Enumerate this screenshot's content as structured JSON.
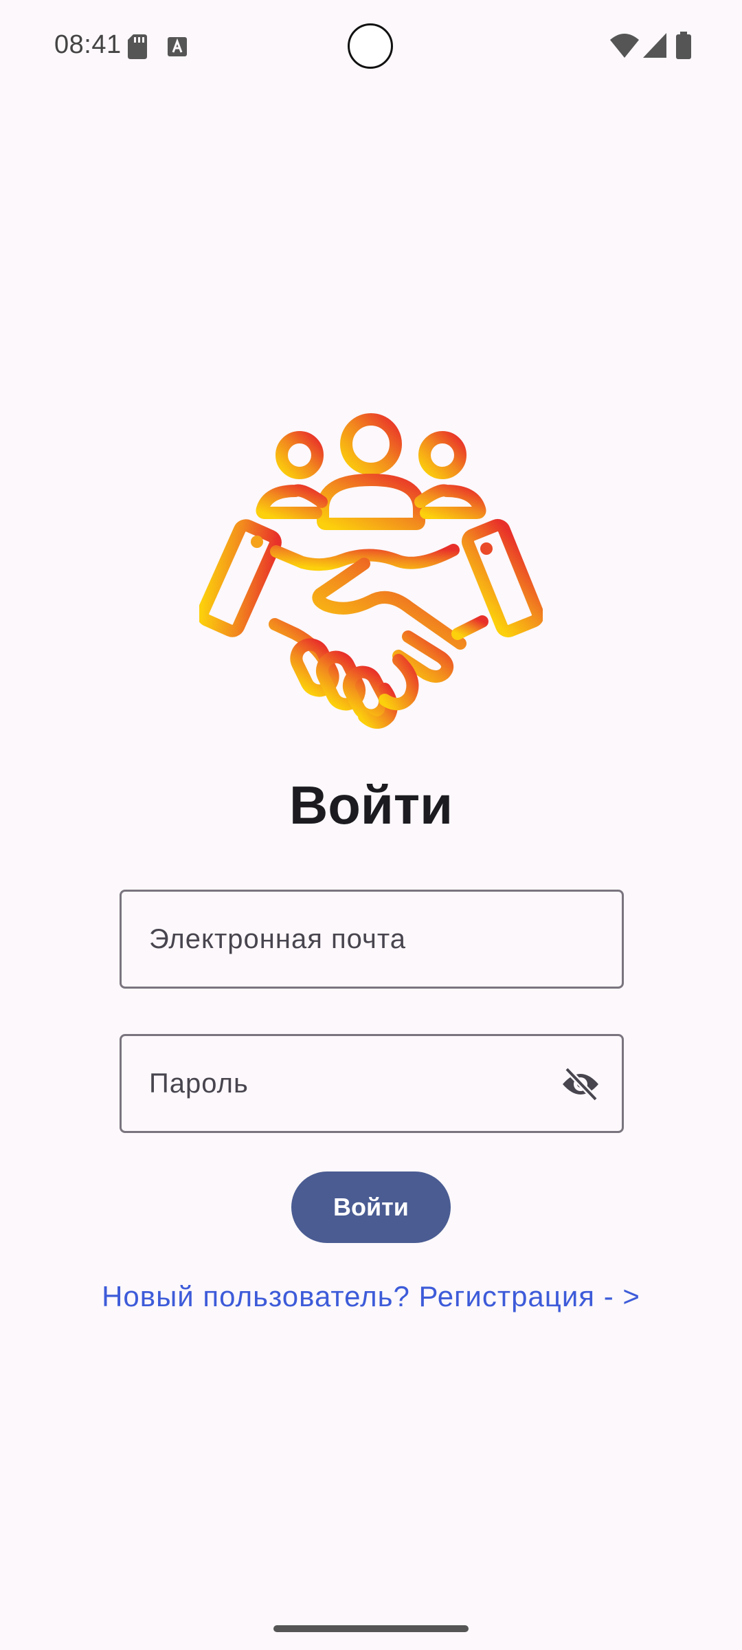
{
  "status_bar": {
    "time": "08:41",
    "icons": [
      "sd-card-icon",
      "text-a-icon",
      "wifi-icon",
      "signal-icon",
      "battery-icon"
    ]
  },
  "logo": {
    "icon": "handshake-team-icon",
    "gradient": [
      "#fcc80e",
      "#f28a1e",
      "#e8352a"
    ]
  },
  "login": {
    "title": "Войти",
    "email_placeholder": "Электронная почта",
    "password_placeholder": "Пароль",
    "password_toggle_icon": "eye-off-icon",
    "submit_label": "Войти",
    "register_link": "Новый пользователь? Регистрация - >"
  },
  "colors": {
    "background": "#fcf8fb",
    "button": "#4a5c92",
    "link": "#3d5bd9",
    "field_border": "#79747e"
  }
}
